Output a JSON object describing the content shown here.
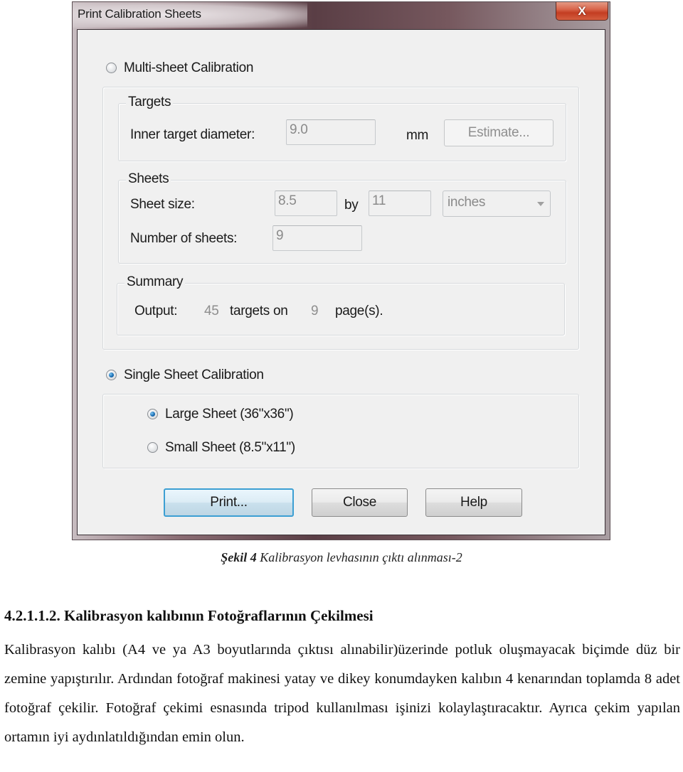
{
  "window": {
    "title": "Print Calibration Sheets",
    "close_glyph": "X"
  },
  "multi_sheet": {
    "label": "Multi-sheet Calibration",
    "selected": false,
    "targets": {
      "group_label": "Targets",
      "inner_diameter_label": "Inner target diameter:",
      "inner_diameter_value": "9.0",
      "unit": "mm",
      "estimate_button": "Estimate..."
    },
    "sheets": {
      "group_label": "Sheets",
      "sheet_size_label": "Sheet size:",
      "width_value": "8.5",
      "by_label": "by",
      "height_value": "11",
      "unit_selected": "inches",
      "number_label": "Number of sheets:",
      "number_value": "9"
    },
    "summary": {
      "group_label": "Summary",
      "output_label": "Output:",
      "targets_count": "45",
      "targets_on_label": "targets on",
      "pages_count": "9",
      "pages_label": "page(s)."
    }
  },
  "single_sheet": {
    "label": "Single Sheet Calibration",
    "selected": true,
    "options": [
      {
        "label": "Large Sheet (36\"x36\")",
        "selected": true
      },
      {
        "label": "Small Sheet (8.5\"x11\")",
        "selected": false
      }
    ]
  },
  "buttons": {
    "print": "Print...",
    "close": "Close",
    "help": "Help"
  },
  "document": {
    "caption_bold": "Şekil 4",
    "caption_text": " Kalibrasyon levhasının çıktı alınması-2",
    "heading": "4.2.1.1.2. Kalibrasyon kalıbının Fotoğraflarının Çekilmesi",
    "paragraph": "Kalibrasyon kalıbı (A4 ve ya A3 boyutlarında çıktısı alınabilir)üzerinde potluk oluşmayacak biçimde düz bir zemine yapıştırılır. Ardından fotoğraf makinesi yatay ve dikey konumdayken kalıbın 4 kenarından toplamda 8 adet fotoğraf çekilir. Fotoğraf çekimi esnasında tripod kullanılması işinizi kolaylaştıracaktır. Ayrıca çekim yapılan ortamın iyi aydınlatıldığından emin olun."
  }
}
